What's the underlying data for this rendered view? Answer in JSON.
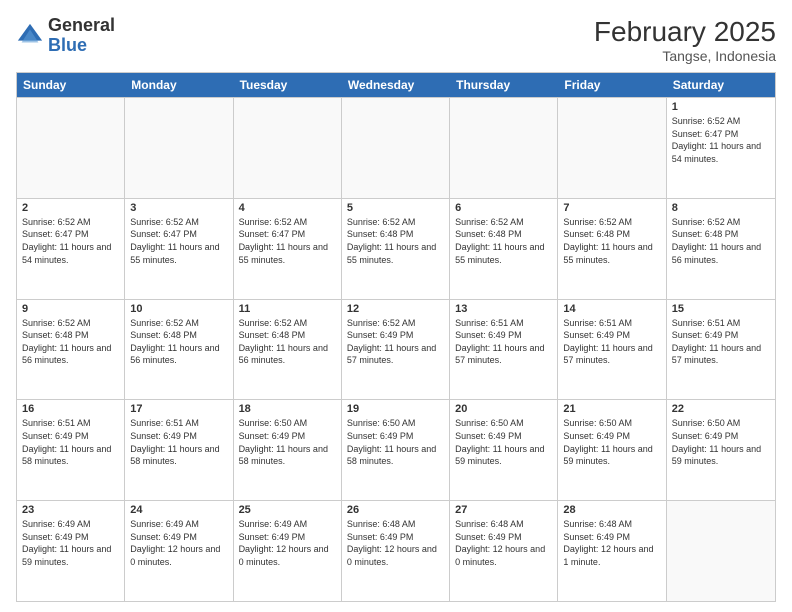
{
  "header": {
    "logo_general": "General",
    "logo_blue": "Blue",
    "month_title": "February 2025",
    "subtitle": "Tangse, Indonesia"
  },
  "days": [
    "Sunday",
    "Monday",
    "Tuesday",
    "Wednesday",
    "Thursday",
    "Friday",
    "Saturday"
  ],
  "weeks": [
    [
      {
        "day": "",
        "empty": true
      },
      {
        "day": "",
        "empty": true
      },
      {
        "day": "",
        "empty": true
      },
      {
        "day": "",
        "empty": true
      },
      {
        "day": "",
        "empty": true
      },
      {
        "day": "",
        "empty": true
      },
      {
        "day": "1",
        "sunrise": "Sunrise: 6:52 AM",
        "sunset": "Sunset: 6:47 PM",
        "daylight": "Daylight: 11 hours and 54 minutes."
      }
    ],
    [
      {
        "day": "2",
        "sunrise": "Sunrise: 6:52 AM",
        "sunset": "Sunset: 6:47 PM",
        "daylight": "Daylight: 11 hours and 54 minutes."
      },
      {
        "day": "3",
        "sunrise": "Sunrise: 6:52 AM",
        "sunset": "Sunset: 6:47 PM",
        "daylight": "Daylight: 11 hours and 55 minutes."
      },
      {
        "day": "4",
        "sunrise": "Sunrise: 6:52 AM",
        "sunset": "Sunset: 6:47 PM",
        "daylight": "Daylight: 11 hours and 55 minutes."
      },
      {
        "day": "5",
        "sunrise": "Sunrise: 6:52 AM",
        "sunset": "Sunset: 6:48 PM",
        "daylight": "Daylight: 11 hours and 55 minutes."
      },
      {
        "day": "6",
        "sunrise": "Sunrise: 6:52 AM",
        "sunset": "Sunset: 6:48 PM",
        "daylight": "Daylight: 11 hours and 55 minutes."
      },
      {
        "day": "7",
        "sunrise": "Sunrise: 6:52 AM",
        "sunset": "Sunset: 6:48 PM",
        "daylight": "Daylight: 11 hours and 55 minutes."
      },
      {
        "day": "8",
        "sunrise": "Sunrise: 6:52 AM",
        "sunset": "Sunset: 6:48 PM",
        "daylight": "Daylight: 11 hours and 56 minutes."
      }
    ],
    [
      {
        "day": "9",
        "sunrise": "Sunrise: 6:52 AM",
        "sunset": "Sunset: 6:48 PM",
        "daylight": "Daylight: 11 hours and 56 minutes."
      },
      {
        "day": "10",
        "sunrise": "Sunrise: 6:52 AM",
        "sunset": "Sunset: 6:48 PM",
        "daylight": "Daylight: 11 hours and 56 minutes."
      },
      {
        "day": "11",
        "sunrise": "Sunrise: 6:52 AM",
        "sunset": "Sunset: 6:48 PM",
        "daylight": "Daylight: 11 hours and 56 minutes."
      },
      {
        "day": "12",
        "sunrise": "Sunrise: 6:52 AM",
        "sunset": "Sunset: 6:49 PM",
        "daylight": "Daylight: 11 hours and 57 minutes."
      },
      {
        "day": "13",
        "sunrise": "Sunrise: 6:51 AM",
        "sunset": "Sunset: 6:49 PM",
        "daylight": "Daylight: 11 hours and 57 minutes."
      },
      {
        "day": "14",
        "sunrise": "Sunrise: 6:51 AM",
        "sunset": "Sunset: 6:49 PM",
        "daylight": "Daylight: 11 hours and 57 minutes."
      },
      {
        "day": "15",
        "sunrise": "Sunrise: 6:51 AM",
        "sunset": "Sunset: 6:49 PM",
        "daylight": "Daylight: 11 hours and 57 minutes."
      }
    ],
    [
      {
        "day": "16",
        "sunrise": "Sunrise: 6:51 AM",
        "sunset": "Sunset: 6:49 PM",
        "daylight": "Daylight: 11 hours and 58 minutes."
      },
      {
        "day": "17",
        "sunrise": "Sunrise: 6:51 AM",
        "sunset": "Sunset: 6:49 PM",
        "daylight": "Daylight: 11 hours and 58 minutes."
      },
      {
        "day": "18",
        "sunrise": "Sunrise: 6:50 AM",
        "sunset": "Sunset: 6:49 PM",
        "daylight": "Daylight: 11 hours and 58 minutes."
      },
      {
        "day": "19",
        "sunrise": "Sunrise: 6:50 AM",
        "sunset": "Sunset: 6:49 PM",
        "daylight": "Daylight: 11 hours and 58 minutes."
      },
      {
        "day": "20",
        "sunrise": "Sunrise: 6:50 AM",
        "sunset": "Sunset: 6:49 PM",
        "daylight": "Daylight: 11 hours and 59 minutes."
      },
      {
        "day": "21",
        "sunrise": "Sunrise: 6:50 AM",
        "sunset": "Sunset: 6:49 PM",
        "daylight": "Daylight: 11 hours and 59 minutes."
      },
      {
        "day": "22",
        "sunrise": "Sunrise: 6:50 AM",
        "sunset": "Sunset: 6:49 PM",
        "daylight": "Daylight: 11 hours and 59 minutes."
      }
    ],
    [
      {
        "day": "23",
        "sunrise": "Sunrise: 6:49 AM",
        "sunset": "Sunset: 6:49 PM",
        "daylight": "Daylight: 11 hours and 59 minutes."
      },
      {
        "day": "24",
        "sunrise": "Sunrise: 6:49 AM",
        "sunset": "Sunset: 6:49 PM",
        "daylight": "Daylight: 12 hours and 0 minutes."
      },
      {
        "day": "25",
        "sunrise": "Sunrise: 6:49 AM",
        "sunset": "Sunset: 6:49 PM",
        "daylight": "Daylight: 12 hours and 0 minutes."
      },
      {
        "day": "26",
        "sunrise": "Sunrise: 6:48 AM",
        "sunset": "Sunset: 6:49 PM",
        "daylight": "Daylight: 12 hours and 0 minutes."
      },
      {
        "day": "27",
        "sunrise": "Sunrise: 6:48 AM",
        "sunset": "Sunset: 6:49 PM",
        "daylight": "Daylight: 12 hours and 0 minutes."
      },
      {
        "day": "28",
        "sunrise": "Sunrise: 6:48 AM",
        "sunset": "Sunset: 6:49 PM",
        "daylight": "Daylight: 12 hours and 1 minute."
      },
      {
        "day": "",
        "empty": true
      }
    ]
  ]
}
